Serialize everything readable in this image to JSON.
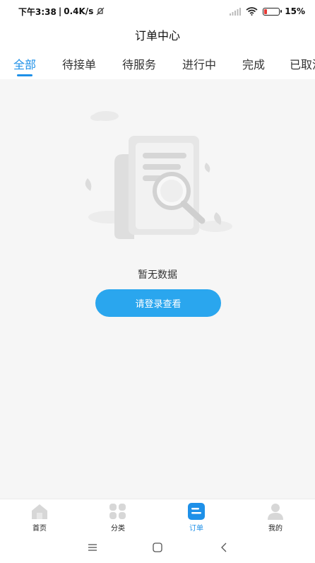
{
  "status_bar": {
    "time": "下午3:38",
    "net_speed": "0.4K/s",
    "battery": "15%"
  },
  "header": {
    "title": "订单中心"
  },
  "tabs": [
    {
      "label": "全部",
      "active": true
    },
    {
      "label": "待接单",
      "active": false
    },
    {
      "label": "待服务",
      "active": false
    },
    {
      "label": "进行中",
      "active": false
    },
    {
      "label": "完成",
      "active": false
    },
    {
      "label": "已取消",
      "active": false
    }
  ],
  "empty_state": {
    "message": "暂无数据",
    "login_button": "请登录查看",
    "illustration_icon": "document-search-icon"
  },
  "bottom_nav": [
    {
      "label": "首页",
      "icon": "home-icon",
      "active": false
    },
    {
      "label": "分类",
      "icon": "grid-icon",
      "active": false
    },
    {
      "label": "订单",
      "icon": "order-icon",
      "active": true
    },
    {
      "label": "我的",
      "icon": "profile-icon",
      "active": false
    }
  ],
  "colors": {
    "accent": "#1e90e8",
    "button": "#2aa6ee",
    "content_bg": "#f6f6f6",
    "battery_low": "#e53935"
  }
}
